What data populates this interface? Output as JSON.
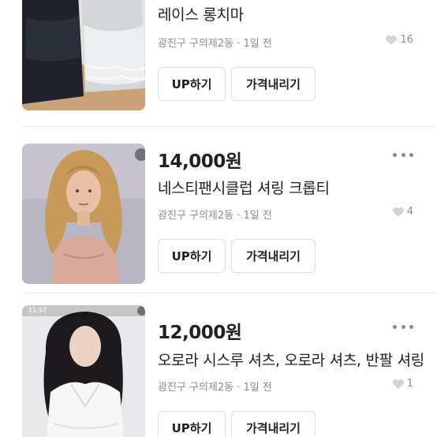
{
  "items": [
    {
      "title": "레이스 롱치마",
      "meta": "광진구 구의제2동 · 1일 전",
      "likes": "16",
      "up_label": "UP하기",
      "price_label": "가격내리기"
    },
    {
      "price": "14,000원",
      "title": "네스티팬시클럽 셔링 크롭티",
      "meta": "광진구 구의제2동 · 1일 전",
      "likes": "4",
      "up_label": "UP하기",
      "price_label": "가격내리기"
    },
    {
      "price": "12,000원",
      "title": "오로라 시스루 셔츠, 오로라 셔츠, 반팔 셔링",
      "meta": "광진구 구의제2동 · 1일 전",
      "likes": "1",
      "up_label": "UP하기",
      "price_label": "가격내리기",
      "photo_status_time": "11:57"
    }
  ],
  "icons": {
    "likes": "heart-icon",
    "more": "more-dots-icon"
  },
  "colors": {
    "text": "#212124",
    "muted": "#868b94",
    "border": "#dcdee3"
  }
}
